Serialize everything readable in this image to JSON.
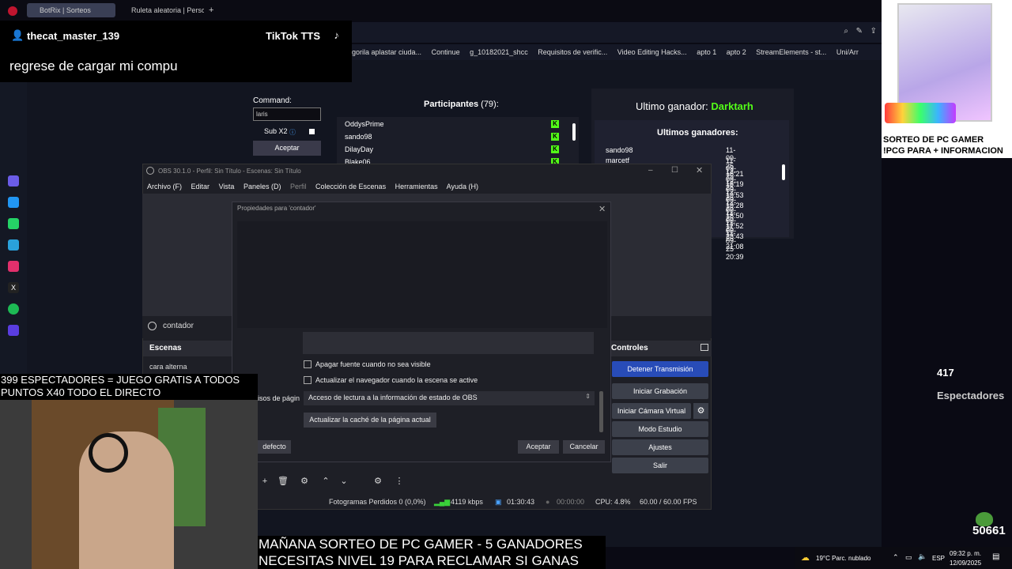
{
  "browser": {
    "tabs": [
      {
        "label": "BotRix | Sorteos",
        "active": true
      },
      {
        "label": "Ruleta aleatoria | Personali",
        "active": false
      }
    ],
    "new_tab": "+",
    "bookmarks": [
      "gorila aplastar ciuda...",
      "Continue",
      "g_10182021_shcc",
      "Requisitos de verific...",
      "Video Editing Hacks...",
      "apto 1",
      "apto 2",
      "StreamElements - st...",
      "Uni/Arr"
    ]
  },
  "tts": {
    "username": "thecat_master_139",
    "brand": "TikTok TTS",
    "message": "regrese de cargar mi compu"
  },
  "page": {
    "command_label": "Command:",
    "command_value": "laris",
    "sub_label": "Sub X2",
    "accept_label": "Aceptar",
    "participants_title": "Participantes",
    "participants_count": "(79):",
    "participants": [
      "OddysPrime",
      "sando98",
      "DilayDay",
      "Blake06"
    ],
    "last_winner_label": "Ultimo ganador:",
    "last_winner_name": "Darktarh",
    "last_winners_title": "Ultimos ganadores:",
    "last_winners": [
      {
        "name": "sando98",
        "date": "11-09-25 18:21"
      },
      {
        "name": "marcetf",
        "date": "11-09-25 18:19"
      },
      {
        "name": "",
        "date": "12-09-25 19:53"
      },
      {
        "name": "",
        "date": "12-09-25 19:28"
      },
      {
        "name": "",
        "date": "12-09-25 18:50"
      },
      {
        "name": "",
        "date": "12-09-25 17:52"
      },
      {
        "name": "",
        "date": "11-09-25 23:43"
      },
      {
        "name": "",
        "date": "11-09-25 21:08"
      },
      {
        "name": "",
        "date": "11-09-25 20:39"
      }
    ]
  },
  "obs": {
    "title": "OBS 30.1.0 - Perfil: Sin Título - Escenas: Sin Título",
    "menu": [
      "Archivo (F)",
      "Editar",
      "Vista",
      "Paneles (D)",
      "Perfil",
      "Colección de Escenas",
      "Herramientas",
      "Ayuda (H)"
    ],
    "source_name": "contador",
    "scenes_header": "Escenas",
    "scene_item": "cara alterna",
    "controls_header": "Controles",
    "controls": [
      "Detener Transmisión",
      "Iniciar Grabación",
      "Iniciar Cámara Virtual",
      "Modo Estudio",
      "Ajustes",
      "Salir"
    ],
    "status": {
      "dropped": "Fotogramas Perdidos 0 (0,0%)",
      "bitrate": "4119 kbps",
      "live_time": "01:30:43",
      "rec_time": "00:00:00",
      "cpu": "CPU: 4.8%",
      "fps": "60.00 / 60.00 FPS"
    }
  },
  "dialog": {
    "title": "Propiedades para 'contador'",
    "checkbox_1": "Apagar fuente cuando no sea visible",
    "checkbox_2": "Actualizar el navegador cuando la escena se active",
    "perm_label": "isos de págin",
    "perm_value": "Acceso de lectura a la información de estado de OBS",
    "refresh_label": "Actualizar la caché de la página actual",
    "defaults_label": "defecto",
    "ok_label": "Aceptar",
    "cancel_label": "Cancelar"
  },
  "overlay": {
    "banner_top": [
      "399 ESPECTADORES = JUEGO GRATIS A TODOS",
      "PUNTOS X40 TODO EL DIRECTO"
    ],
    "banner_bottom": [
      "MAÑANA SORTEO DE PC GAMER - 5 GANADORES",
      "NECESITAS NIVEL 19 PARA RECLAMAR SI GANAS"
    ],
    "pc_ad": [
      "SORTEO DE PC GAMER",
      "!PCG PARA + INFORMACION"
    ],
    "viewers_count": "417",
    "viewers_label": "Espectadores",
    "counter": "50661"
  },
  "taskbar": {
    "weather": "19°C  Parc. nublado",
    "lang": "ESP",
    "time": "09:32 p. m.",
    "date": "12/09/2025"
  },
  "colors": {
    "accent_green": "#53fc18",
    "obs_blue": "#284cb8"
  }
}
